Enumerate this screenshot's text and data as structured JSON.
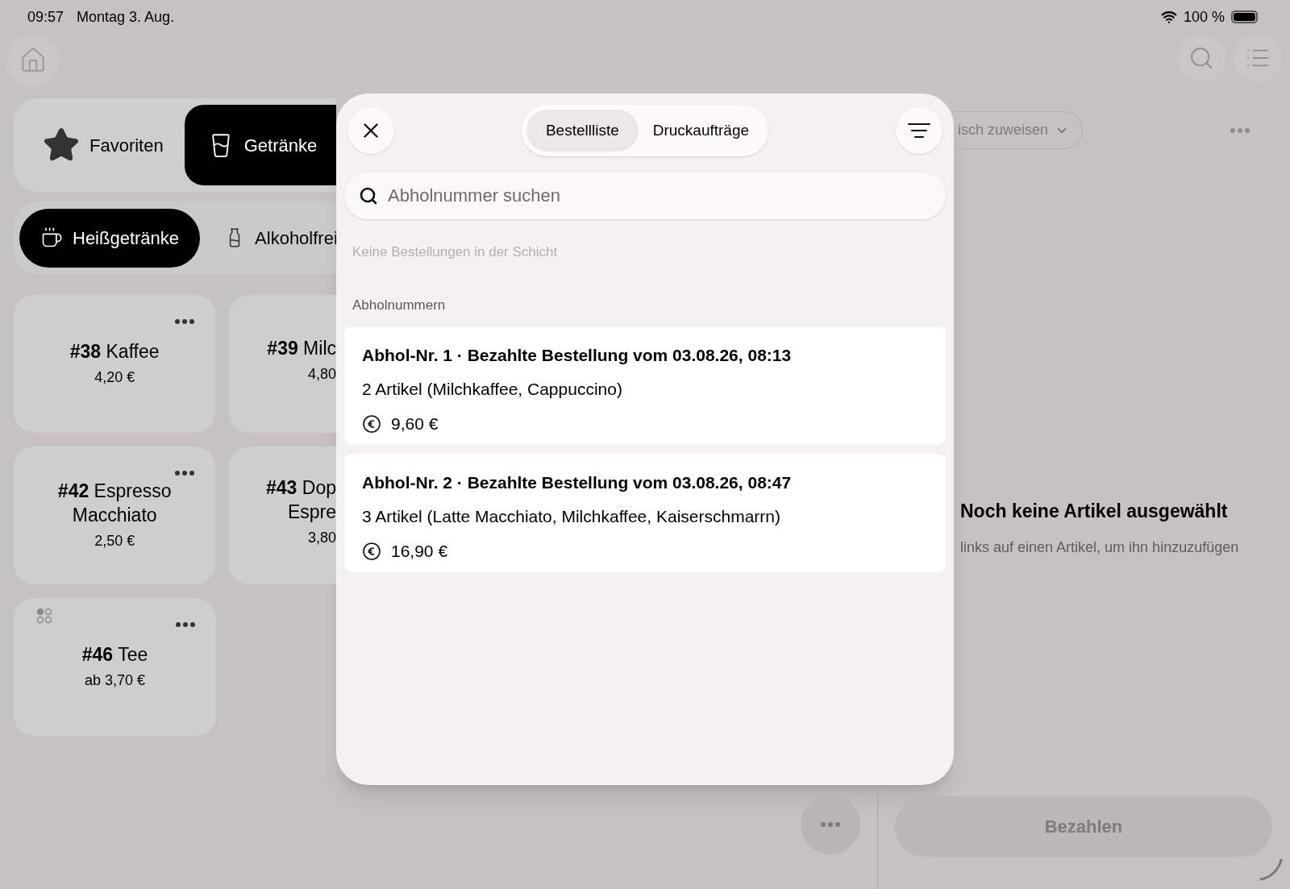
{
  "status_bar": {
    "time": "09:57",
    "date": "Montag 3. Aug.",
    "battery": "100 %"
  },
  "categories": [
    {
      "label": "Favoriten",
      "selected": false
    },
    {
      "label": "Getränke",
      "selected": true
    }
  ],
  "subcategories": [
    {
      "label": "Heißgetränke",
      "selected": true
    },
    {
      "label": "Alkoholfrei",
      "selected": false
    }
  ],
  "products": [
    {
      "title_lines": [
        "**#38** Kaffee"
      ],
      "price": "4,20 €",
      "variants": false,
      "cut": false
    },
    {
      "title_lines": [
        "**#39** Milc"
      ],
      "price": "4,80",
      "variants": false,
      "cut": true
    },
    {
      "title_lines": [
        "**#42** Espresso",
        "Macchiato"
      ],
      "price": "2,50 €",
      "variants": false,
      "cut": false
    },
    {
      "title_lines": [
        "**#43** Dop",
        "Espre"
      ],
      "price": "3,80",
      "variants": false,
      "cut": true
    },
    {
      "title_lines": [
        "**#46** Tee"
      ],
      "price": "ab 3,70 €",
      "variants": true,
      "cut": false
    }
  ],
  "modal": {
    "tabs": [
      {
        "label": "Bestellliste",
        "selected": true
      },
      {
        "label": "Druckaufträge",
        "selected": false
      }
    ],
    "search": {
      "placeholder": "Abholnummer suchen"
    },
    "empty_note": "Keine Bestellungen in der Schicht",
    "section_label": "Abholnummern",
    "orders": [
      {
        "title": "Abhol-Nr. 1 · Bezahlte Bestellung vom 03.08.26, 08:13",
        "items": "2 Artikel (Milchkaffee, Cappuccino)",
        "total": "9,60 €"
      },
      {
        "title": "Abhol-Nr. 2 · Bezahlte Bestellung vom 03.08.26, 08:47",
        "items": "3 Artikel (Latte Macchiato, Milchkaffee, Kaiserschmarrn)",
        "total": "16,90 €"
      }
    ]
  },
  "right_panel": {
    "table_button": "isch zuweisen",
    "empty_title": "Noch keine Artikel ausgewählt",
    "empty_hint": "links auf einen Artikel, um ihn hinzuzufügen",
    "pay_button": {
      "label": "Bezahlen",
      "disabled": true
    }
  }
}
